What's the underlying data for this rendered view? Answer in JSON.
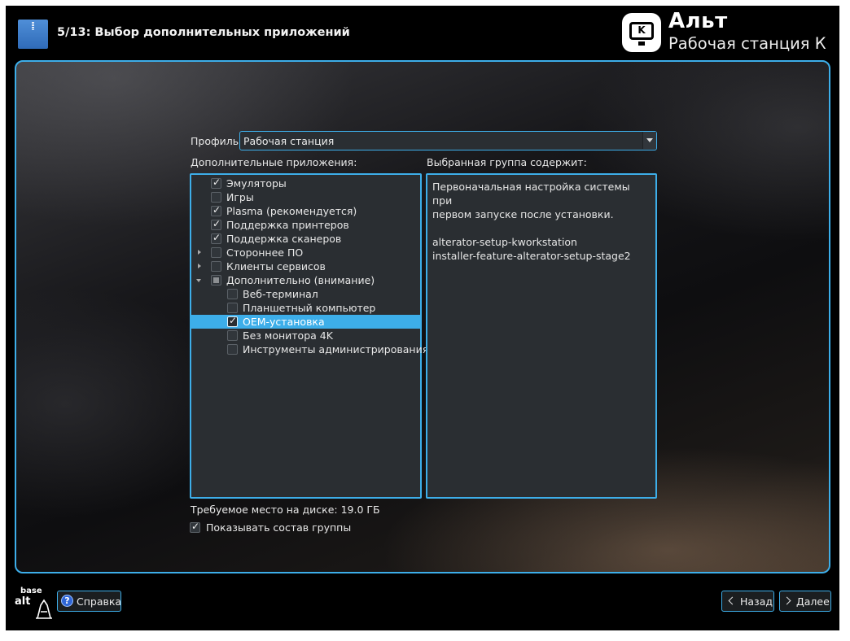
{
  "header": {
    "step_title": "5/13: Выбор дополнительных приложений",
    "brand_logo_letter": "K",
    "brand_name": "Альт",
    "brand_edition": "Рабочая станция К"
  },
  "profile": {
    "label": "Профиль:",
    "value": "Рабочая станция"
  },
  "apps": {
    "label": "Дополнительные приложения:",
    "items": [
      {
        "label": "Эмуляторы",
        "checked": true,
        "level": 0
      },
      {
        "label": "Игры",
        "checked": false,
        "level": 0
      },
      {
        "label": "Plasma (рекомендуется)",
        "checked": true,
        "level": 0
      },
      {
        "label": "Поддержка принтеров",
        "checked": true,
        "level": 0
      },
      {
        "label": "Поддержка сканеров",
        "checked": true,
        "level": 0
      },
      {
        "label": "Стороннее ПО",
        "checked": false,
        "level": 0,
        "expander": "collapsed"
      },
      {
        "label": "Клиенты сервисов",
        "checked": false,
        "level": 0,
        "expander": "collapsed"
      },
      {
        "label": "Дополнительно (внимание)",
        "checked": "partial",
        "level": 0,
        "expander": "expanded"
      },
      {
        "label": "Веб-терминал",
        "checked": false,
        "level": 1
      },
      {
        "label": "Планшетный компьютер",
        "checked": false,
        "level": 1
      },
      {
        "label": "OEM-установка",
        "checked": true,
        "level": 1,
        "selected": true
      },
      {
        "label": "Без монитора 4K",
        "checked": false,
        "level": 1
      },
      {
        "label": "Инструменты администрирования",
        "checked": false,
        "level": 1
      }
    ]
  },
  "group": {
    "label": "Выбранная группа содержит:",
    "description": "Первоначальная настройка системы при\nпервом запуске после установки.\n\nalterator-setup-kworkstation\ninstaller-feature-alterator-setup-stage2"
  },
  "disk_space": "Требуемое место на диске: 19.0 ГБ",
  "show_group": {
    "label": "Показывать состав группы",
    "checked": true
  },
  "footer": {
    "logo_top": "base",
    "logo_bottom": "alt",
    "help_label": "Справка",
    "help_icon": "?",
    "back_label": "Назад",
    "next_label": "Далее"
  },
  "colors": {
    "accent": "#3daee9",
    "panel": "#2a2e32",
    "background": "#000000"
  }
}
